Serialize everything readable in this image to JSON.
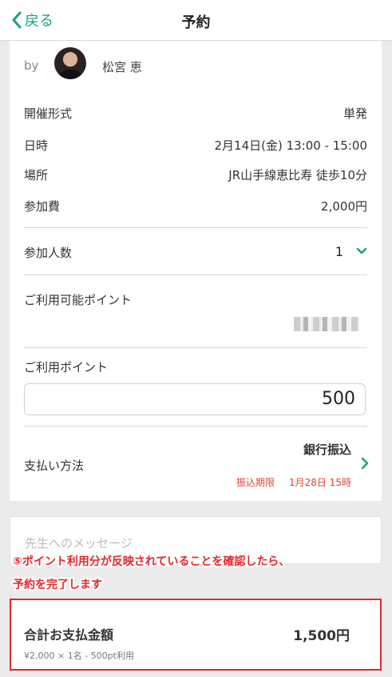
{
  "nav": {
    "back_label": "戻る",
    "title": "予約"
  },
  "host": {
    "by_label": "by",
    "name": "松宮 恵"
  },
  "details": [
    {
      "label": "開催形式",
      "value": "単発"
    },
    {
      "label": "日時",
      "value": "2月14日(金) 13:00 - 15:00"
    },
    {
      "label": "場所",
      "value": "JR山手線恵比寿 徒歩10分"
    },
    {
      "label": "参加費",
      "value": "2,000円"
    }
  ],
  "participants": {
    "label": "参加人数",
    "value": "1"
  },
  "available_points": {
    "label": "ご利用可能ポイント"
  },
  "use_points": {
    "label": "ご利用ポイント",
    "value": "500"
  },
  "payment": {
    "label": "支払い方法",
    "method": "銀行振込",
    "deadline_label": "振込期限",
    "deadline_value": "1月28日 15時"
  },
  "message": {
    "placeholder": "先生へのメッセージ"
  },
  "annotation": {
    "line1": "⑤ポイント利用分が反映されていることを確認したら、",
    "line2": "予約を完了します"
  },
  "total": {
    "label": "合計お支払金額",
    "value": "1,500円",
    "detail": "¥2,000 × 1名 - 500pt利用"
  },
  "colors": {
    "accent": "#1aa37a",
    "alert": "#e8262a"
  }
}
